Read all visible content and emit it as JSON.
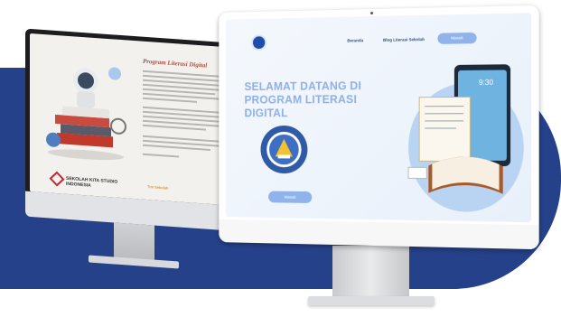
{
  "back_screen": {
    "title": "Program Literasi Digital",
    "logo_text": "SEKOLAH KITA\nSTUDIO INDONESIA",
    "footer_label": "Tim Sekolah"
  },
  "front_screen": {
    "nav": {
      "link_1": "Beranda",
      "link_2": "Blog Literasi Sekolah",
      "button": "Masuk"
    },
    "hero_title": "SELAMAT DATANG DI PROGRAM LITERASI DIGITAL",
    "hero_button": "Masuk",
    "tablet_time": "9:30"
  },
  "colors": {
    "backdrop": "#25418a",
    "accent": "#8fb3ea",
    "hero_text": "#8fb0e6"
  }
}
